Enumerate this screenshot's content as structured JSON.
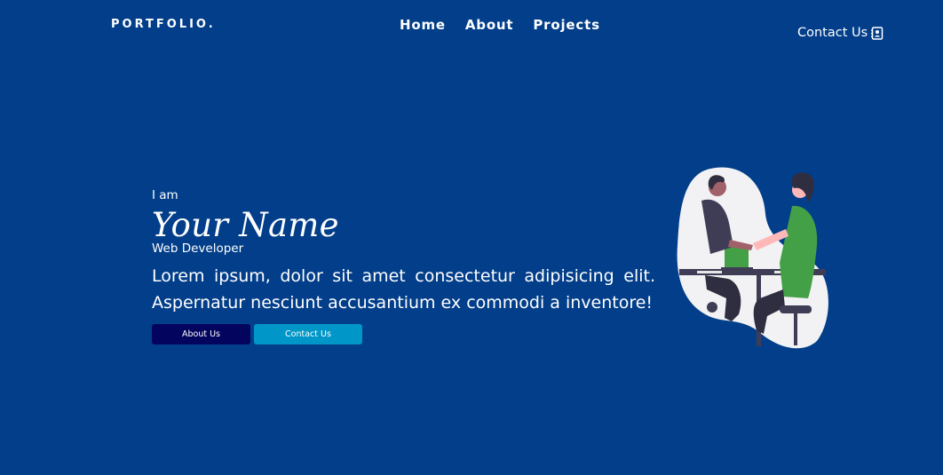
{
  "header": {
    "brand": "PORTFOLIO.",
    "nav": [
      "Home",
      "About",
      "Projects"
    ],
    "contact_label": "Contact Us"
  },
  "hero": {
    "intro": "I am",
    "name": "Your Name",
    "role": "Web Developer",
    "description": "Lorem ipsum, dolor sit amet consectetur adipisicing elit. Aspernatur nesciunt accusantium ex commodi a inventore!",
    "buttons": {
      "about": "About Us",
      "contact": "Contact Us"
    }
  },
  "icons": {
    "contact": "contact-book-icon",
    "illustration": "handshake-illustration"
  },
  "colors": {
    "background": "#023e8a",
    "about_button": "#03045e",
    "contact_button": "#0096c7",
    "text": "#ffffff"
  }
}
